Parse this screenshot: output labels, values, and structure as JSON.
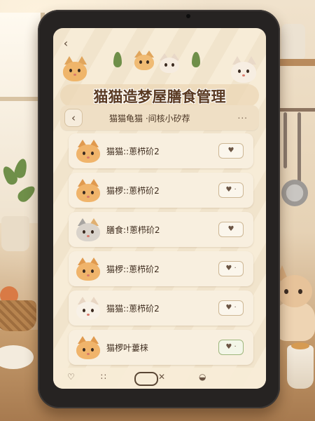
{
  "app": {
    "title": "猫猫造梦屋膳食管理",
    "back_icon": "chevron-left-icon"
  },
  "subheader": {
    "back_label": "‹",
    "title": "猫猫龟猫 ·间核小矽荐",
    "more_label": "..."
  },
  "items": [
    {
      "label": "猫猫::蔥栉砎2",
      "cat": "orange",
      "like": "♥"
    },
    {
      "label": "猫椤::蔥栉砎2",
      "cat": "orange",
      "like": "♥ ·"
    },
    {
      "label": "膳食:!蔥栉砎2",
      "cat": "gray",
      "like": "♥"
    },
    {
      "label": "猫椤::蔥栉砎2",
      "cat": "orange",
      "like": "♥ ·"
    },
    {
      "label": "猫猫::蔥栉砎2",
      "cat": "white",
      "like": "♥ ·"
    },
    {
      "label": "猫椤叶蔞梾",
      "cat": "orange",
      "like": "♥ ·"
    }
  ],
  "bottom_bar": {
    "icons": [
      "heart-icon",
      "grid-icon",
      "home-pill",
      "close-icon",
      "bowl-icon"
    ],
    "glyphs": {
      "heart": "♡",
      "grid": "∷",
      "close": "✕",
      "bowl": "◒"
    }
  },
  "colors": {
    "screen_bg": "#f7ecd7",
    "title": "#5a3a22",
    "bezel": "#262322"
  }
}
